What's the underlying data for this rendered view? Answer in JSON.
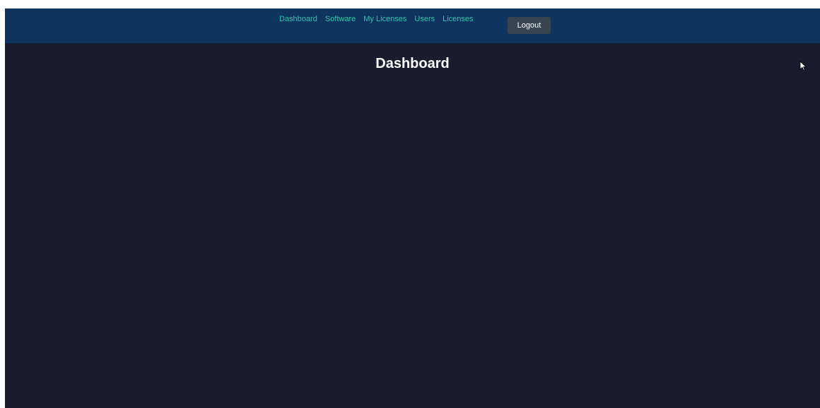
{
  "nav": {
    "links": [
      {
        "label": "Dashboard"
      },
      {
        "label": "Software"
      },
      {
        "label": "My Licenses"
      },
      {
        "label": "Users"
      },
      {
        "label": "Licenses"
      }
    ],
    "logout_label": "Logout"
  },
  "main": {
    "title": "Dashboard"
  },
  "colors": {
    "nav_background": "#0f3460",
    "page_background": "#1a1b2e",
    "link_color": "#2ec7a3",
    "button_background": "#3a4450"
  },
  "icons": {
    "cursor": "mouse-pointer-icon"
  }
}
